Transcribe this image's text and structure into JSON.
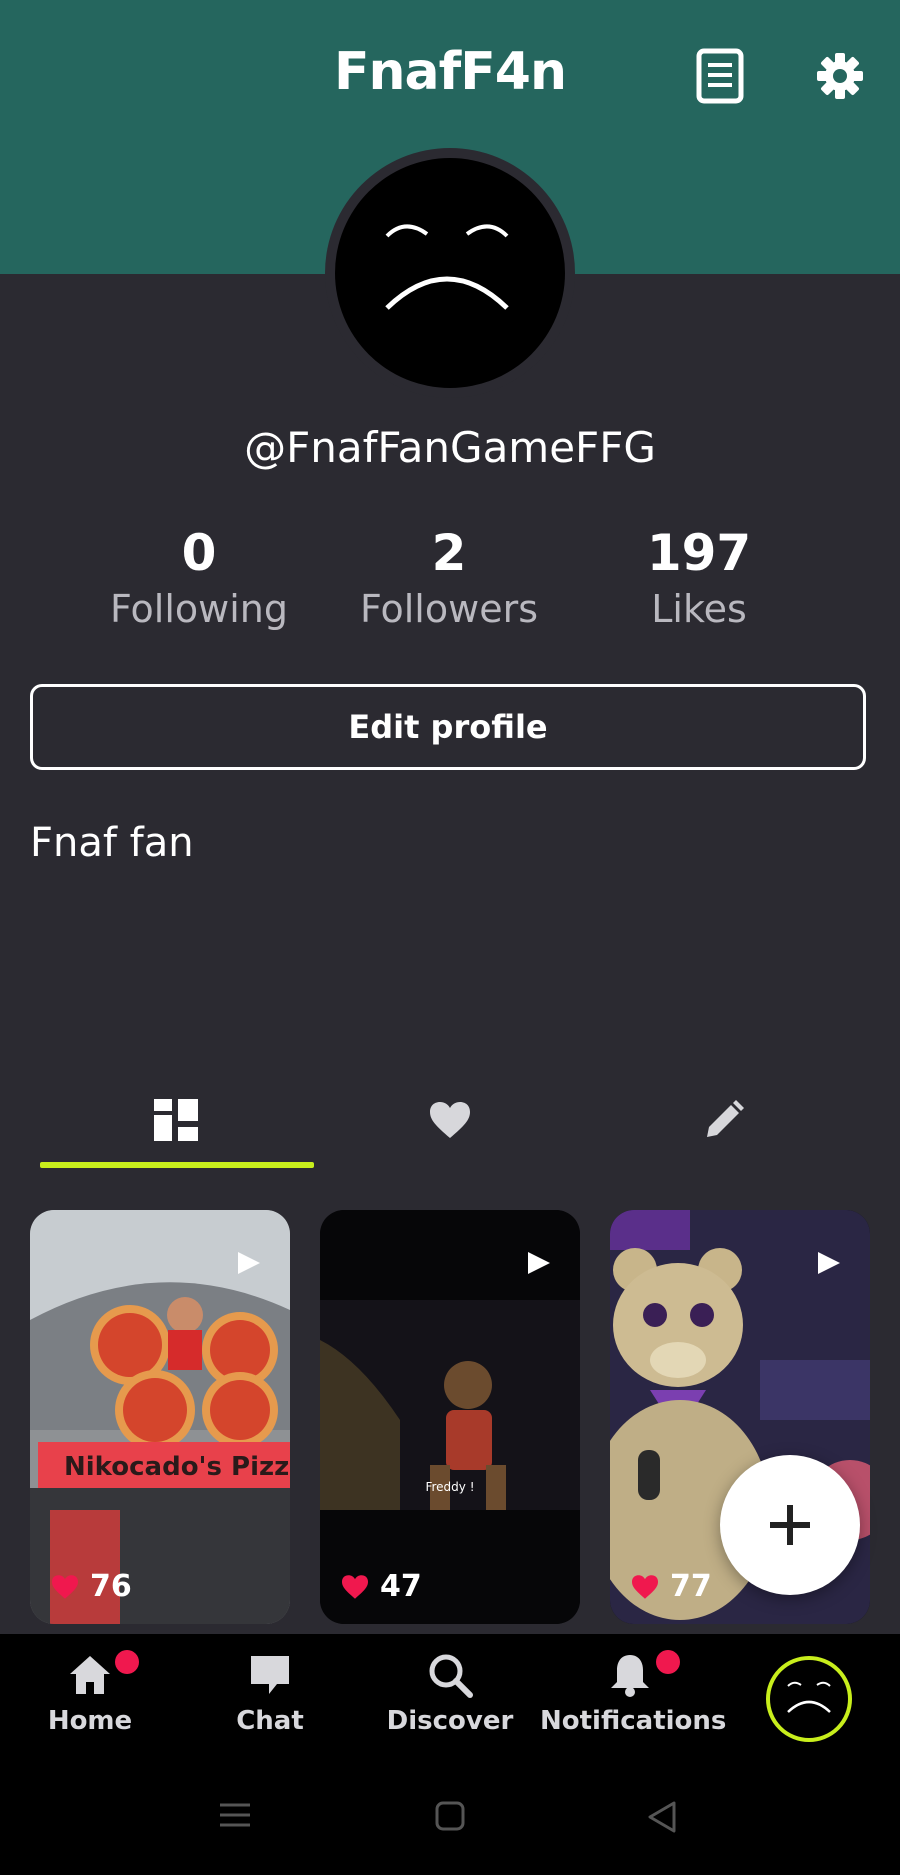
{
  "header": {
    "title": "FnafF4n",
    "icons": [
      "document-icon",
      "gear-icon"
    ],
    "color": "#25665e"
  },
  "profile": {
    "username": "@FnafFanGameFFG",
    "stats": [
      {
        "value": "0",
        "label": "Following"
      },
      {
        "value": "2",
        "label": "Followers"
      },
      {
        "value": "197",
        "label": "Likes"
      }
    ],
    "edit_label": "Edit profile",
    "bio": "Fnaf fan"
  },
  "tabs": [
    {
      "icon": "grid-icon",
      "active": true
    },
    {
      "icon": "heart-icon",
      "active": false
    },
    {
      "icon": "pencil-icon",
      "active": false
    }
  ],
  "videos": [
    {
      "likes": "76",
      "overlay_text": "Nikocado's Pizza"
    },
    {
      "likes": "47",
      "caption": "Freddy !"
    },
    {
      "likes": "77"
    }
  ],
  "nav": {
    "items": [
      {
        "label": "Home",
        "badge": true
      },
      {
        "label": "Chat",
        "badge": false
      },
      {
        "label": "Discover",
        "badge": false
      },
      {
        "label": "Notifications",
        "badge": true
      }
    ]
  },
  "colors": {
    "background": "#2b2a31",
    "accent": "#c8ee1c",
    "badge": "#f0184e",
    "like": "#f0184e"
  }
}
